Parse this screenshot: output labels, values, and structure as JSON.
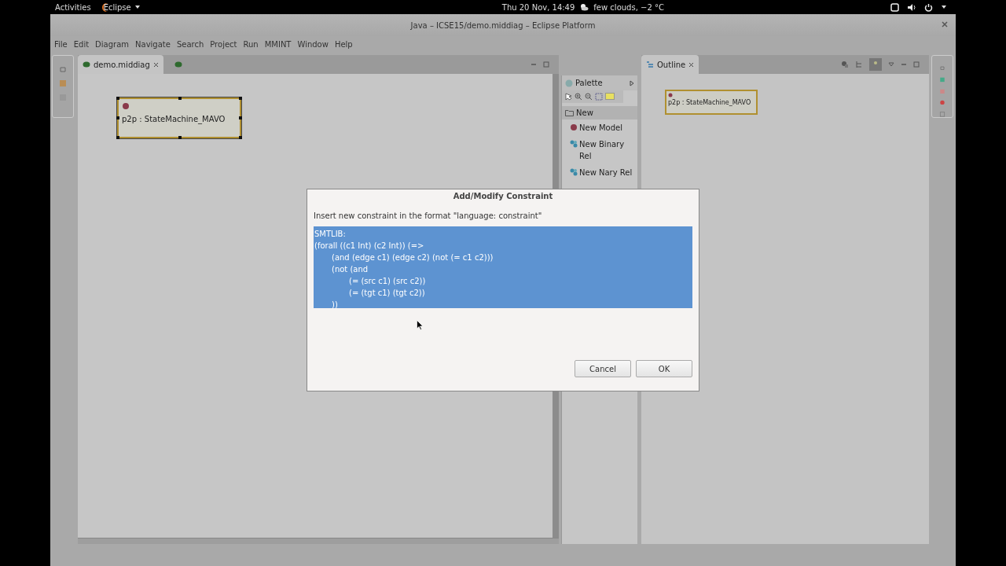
{
  "top_bar": {
    "activities": "Activities",
    "app_menu": "Eclipse",
    "clock": "Thu 20 Nov, 14:49",
    "weather": "few clouds, −2 °C"
  },
  "window": {
    "title": "Java – ICSE15/demo.middiag – Eclipse Platform"
  },
  "menu": [
    "File",
    "Edit",
    "Diagram",
    "Navigate",
    "Search",
    "Project",
    "Run",
    "MMINT",
    "Window",
    "Help"
  ],
  "editor": {
    "tabs": [
      {
        "label": "demo.middiag",
        "selected": true
      },
      {
        "selected": false
      }
    ],
    "node": {
      "label": "p2p : StateMachine_MAVO",
      "selected": true
    }
  },
  "palette": {
    "title": "Palette",
    "drawer": "New",
    "entries": [
      {
        "label": "New Model",
        "kind": "model"
      },
      {
        "label": "New Binary Rel",
        "kind": "rel"
      },
      {
        "label": "New Nary Rel",
        "kind": "rel"
      }
    ]
  },
  "outline": {
    "title": "Outline",
    "node": "p2p : StateMachine_MAVO"
  },
  "dialog": {
    "title": "Add/Modify Constraint",
    "prompt": "Insert new constraint in the format \"language: constraint\"",
    "text_selected": true,
    "lines": [
      "SMTLIB:",
      "(forall ((c1 Int) (c2 Int)) (=>",
      "\t(and (edge c1) (edge c2) (not (= c1 c2)))",
      "\t(not (and",
      "\t\t(= (src c1) (src c2))",
      "\t\t(= (tgt c1) (tgt c2))",
      "\t))"
    ],
    "buttons": [
      "Cancel",
      "OK"
    ]
  }
}
